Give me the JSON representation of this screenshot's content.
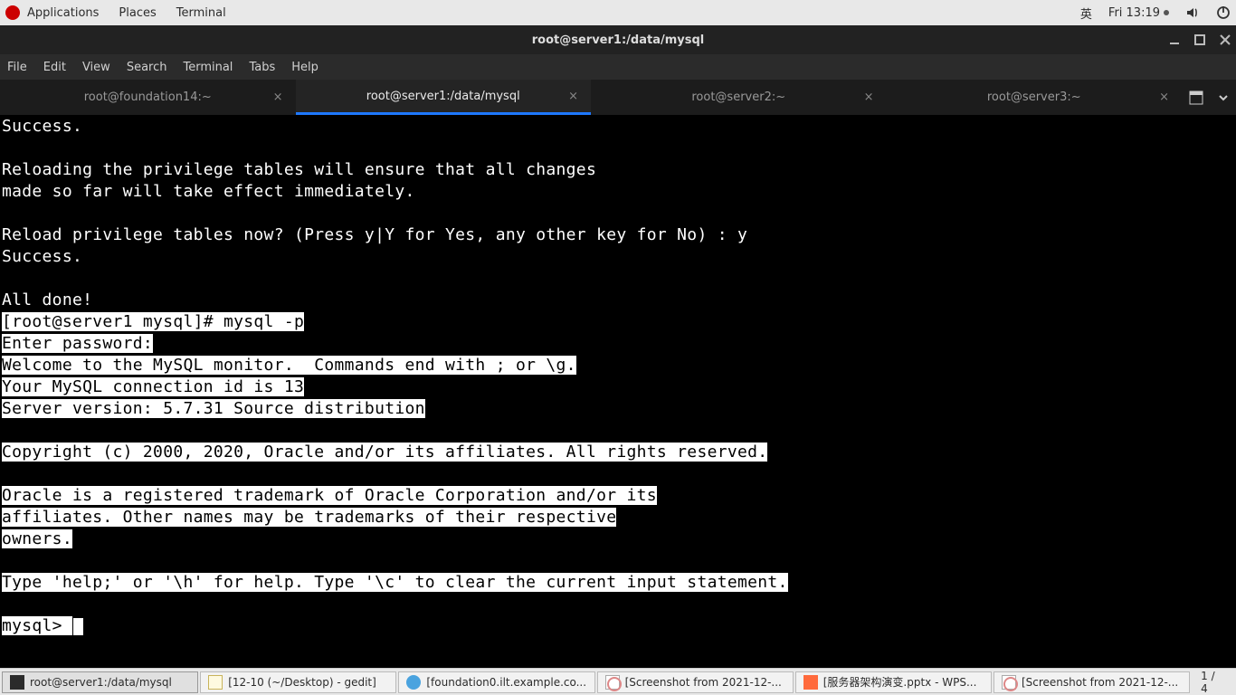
{
  "top_panel": {
    "applications": "Applications",
    "places": "Places",
    "terminal": "Terminal",
    "ime": "英",
    "clock": "Fri 13:19"
  },
  "window": {
    "title": "root@server1:/data/mysql",
    "menubar": [
      "File",
      "Edit",
      "View",
      "Search",
      "Terminal",
      "Tabs",
      "Help"
    ],
    "tabs": [
      {
        "label": "root@foundation14:~"
      },
      {
        "label": "root@server1:/data/mysql",
        "active": true
      },
      {
        "label": "root@server2:~"
      },
      {
        "label": "root@server3:~"
      }
    ]
  },
  "terminal": {
    "pre_lines": "Success.\n\nReloading the privilege tables will ensure that all changes\nmade so far will take effect immediately.\n\nReload privilege tables now? (Press y|Y for Yes, any other key for No) : y\nSuccess.\n\nAll done!",
    "sel_lines": "[root@server1 mysql]# mysql -p\nEnter password:\nWelcome to the MySQL monitor.  Commands end with ; or \\g.\nYour MySQL connection id is 13\nServer version: 5.7.31 Source distribution\n\nCopyright (c) 2000, 2020, Oracle and/or its affiliates. All rights reserved.\n\nOracle is a registered trademark of Oracle Corporation and/or its\naffiliates. Other names may be trademarks of their respective\nowners.\n\nType 'help;' or '\\h' for help. Type '\\c' to clear the current input statement.\n",
    "prompt": "mysql> "
  },
  "taskbar": {
    "items": [
      {
        "icon": "terminal",
        "label": "root@server1:/data/mysql",
        "active": true
      },
      {
        "icon": "gedit",
        "label": "[12-10 (~/Desktop) - gedit]"
      },
      {
        "icon": "browser",
        "label": "[foundation0.ilt.example.co..."
      },
      {
        "icon": "img",
        "label": "[Screenshot from 2021-12-..."
      },
      {
        "icon": "wps",
        "label": "[服务器架构演变.pptx - WPS..."
      },
      {
        "icon": "img",
        "label": "[Screenshot from 2021-12-..."
      }
    ],
    "workspaces": "1 / 4"
  }
}
